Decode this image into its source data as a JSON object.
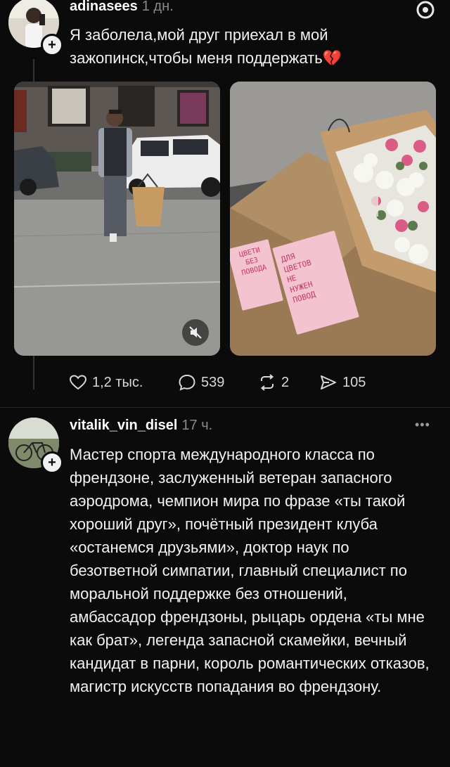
{
  "post1": {
    "username": "adinasees",
    "time": "1 дн.",
    "text": "Я заболела,мой друг приехал в мой зажопинск,чтобы меня поддержать💔",
    "card1_text": [
      "ЦВЕТИ",
      "БЕЗ",
      "ПОВОДА"
    ],
    "card2_text": [
      "ДЛЯ",
      "ЦВЕТОВ",
      "НЕ",
      "НУЖЕН",
      "ПОВОД"
    ],
    "likes": "1,2 тыс.",
    "comments": "539",
    "reposts": "2",
    "shares": "105"
  },
  "post2": {
    "username": "vitalik_vin_disel",
    "time": "17 ч.",
    "menu": "•••",
    "text": "Мастер спорта международного класса по френдзоне, заслуженный ветеран запасного аэродрома, чемпион мира по фразе «ты такой хороший друг», почётный президент клуба «останемся друзьями», доктор наук по безответной симпатии, главный специалист по моральной поддержке без отношений, амбассадор френдзоны, рыцарь ордена «ты мне как брат», легенда запасной скамейки, вечный кандидат в парни, король романтических отказов, магистр искусств попадания во френдзону."
  },
  "icons": {
    "like": "heart-icon",
    "comment": "comment-icon",
    "repost": "repost-icon",
    "share": "send-icon",
    "mute": "muted-speaker-icon",
    "follow": "plus-icon"
  },
  "colors": {
    "background": "#0b0b0b",
    "text": "#f2f2f2",
    "muted": "#8a8a8a"
  }
}
